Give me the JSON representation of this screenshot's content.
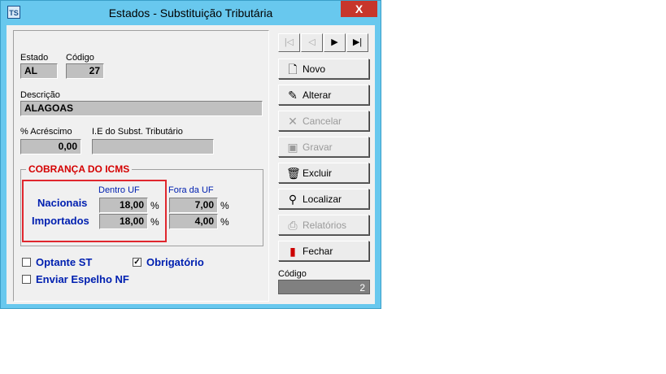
{
  "window": {
    "title": "Estados - Substituição Tributária",
    "app_icon": "TS",
    "close_glyph": "X"
  },
  "nav": {
    "first": "|◁",
    "prev": "◁",
    "next": "▶",
    "last": "▶|"
  },
  "estado": {
    "label": "Estado",
    "value": "AL"
  },
  "codigo": {
    "label": "Código",
    "value": "27"
  },
  "descricao": {
    "label": "Descrição",
    "value": "ALAGOAS"
  },
  "acrescimo": {
    "label": "% Acréscimo",
    "value": "0,00"
  },
  "ie": {
    "label": "I.E do Subst. Tributário",
    "value": ""
  },
  "cobranca": {
    "title": "COBRANÇA DO ICMS",
    "dentro_label": "Dentro UF",
    "fora_label": "Fora da UF",
    "nacionais_label": "Nacionais",
    "importados_label": "Importados",
    "nacionais_dentro": "18,00",
    "nacionais_fora": "7,00",
    "importados_dentro": "18,00",
    "importados_fora": "4,00",
    "pct": "%"
  },
  "checks": {
    "optante_st": {
      "label": "Optante ST",
      "checked": false
    },
    "obrigatorio": {
      "label": "Obrigatório",
      "checked": true,
      "mark": "✓"
    },
    "enviar_espelho": {
      "label": "Enviar Espelho NF",
      "checked": false
    }
  },
  "buttons": {
    "novo": "Novo",
    "alterar": "Alterar",
    "cancelar": "Cancelar",
    "gravar": "Gravar",
    "excluir": "Excluir",
    "localizar": "Localizar",
    "relatorios": "Relatórios",
    "fechar": "Fechar"
  },
  "codigo_side": {
    "label": "Código",
    "value": "2"
  },
  "colors": {
    "title_bg": "#68c8ee",
    "close_red": "#c7362b",
    "group_red": "#d40000",
    "highlight_red": "#e0272e",
    "label_blue": "#0020b0"
  }
}
